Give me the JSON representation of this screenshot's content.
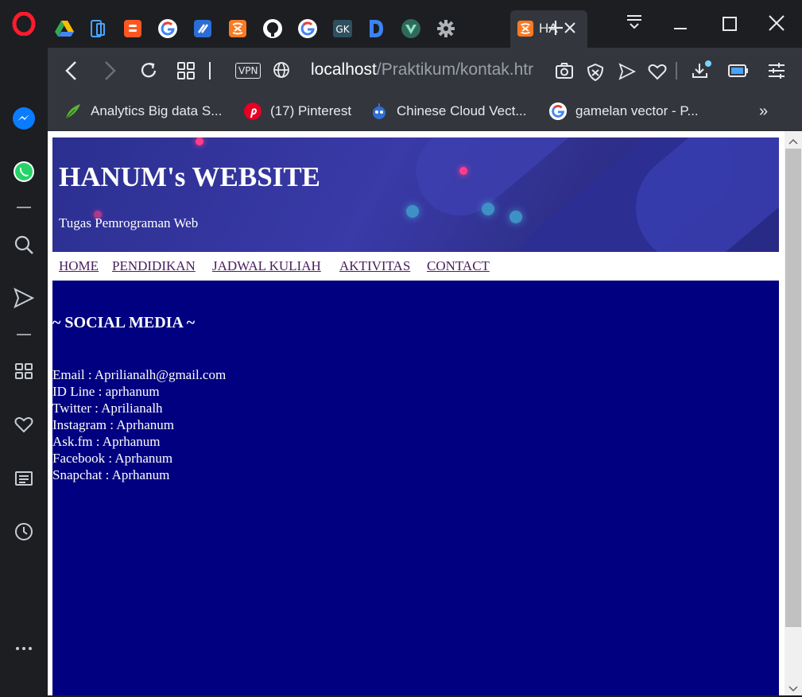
{
  "browser": {
    "tabs": [
      {
        "name": "google-drive-tab"
      },
      {
        "name": "mobile-tab"
      },
      {
        "name": "blogger-tab"
      },
      {
        "name": "google-tab"
      },
      {
        "name": "link-tab"
      },
      {
        "name": "xampp-tab"
      },
      {
        "name": "github-tab"
      },
      {
        "name": "google-tab-2"
      },
      {
        "name": "geeks-tab"
      },
      {
        "name": "d-tab"
      },
      {
        "name": "vue-tab"
      },
      {
        "name": "settings-tab"
      }
    ],
    "active_tab_label": "HA",
    "vpn_label": "VPN",
    "url_host": "localhost",
    "url_path": "/Praktikum/kontak.htr",
    "bookmarks": [
      {
        "label": "Analytics Big data S...",
        "icon": "analytics-icon"
      },
      {
        "label": "(17) Pinterest",
        "icon": "pinterest-icon"
      },
      {
        "label": "Chinese Cloud Vect...",
        "icon": "robot-icon"
      },
      {
        "label": "gamelan vector - P...",
        "icon": "google-icon"
      }
    ],
    "bookmarks_more": "»"
  },
  "site": {
    "title": "HANUM's WEBSITE",
    "subtitle": "Tugas Pemrograman Web",
    "nav": [
      "HOME",
      "PENDIDIKAN",
      "JADWAL KULIAH",
      "AKTIVITAS",
      "CONTACT"
    ],
    "section_title": "~ SOCIAL MEDIA ~",
    "contacts": [
      "Email : Aprilianalh@gmail.com",
      "ID Line : aprhanum",
      "Twitter : Aprilianalh",
      "Instagram : Aprhanum",
      "Ask.fm : Aprhanum",
      "Facebook : Aprhanum",
      "Snapchat : Aprhanum"
    ]
  },
  "colors": {
    "content_bg": "#000080",
    "header_bg": "#2b2f8f",
    "nav_link": "#4a1d5e",
    "browser_dark": "#1c1e22",
    "toolbar": "#33363c"
  }
}
